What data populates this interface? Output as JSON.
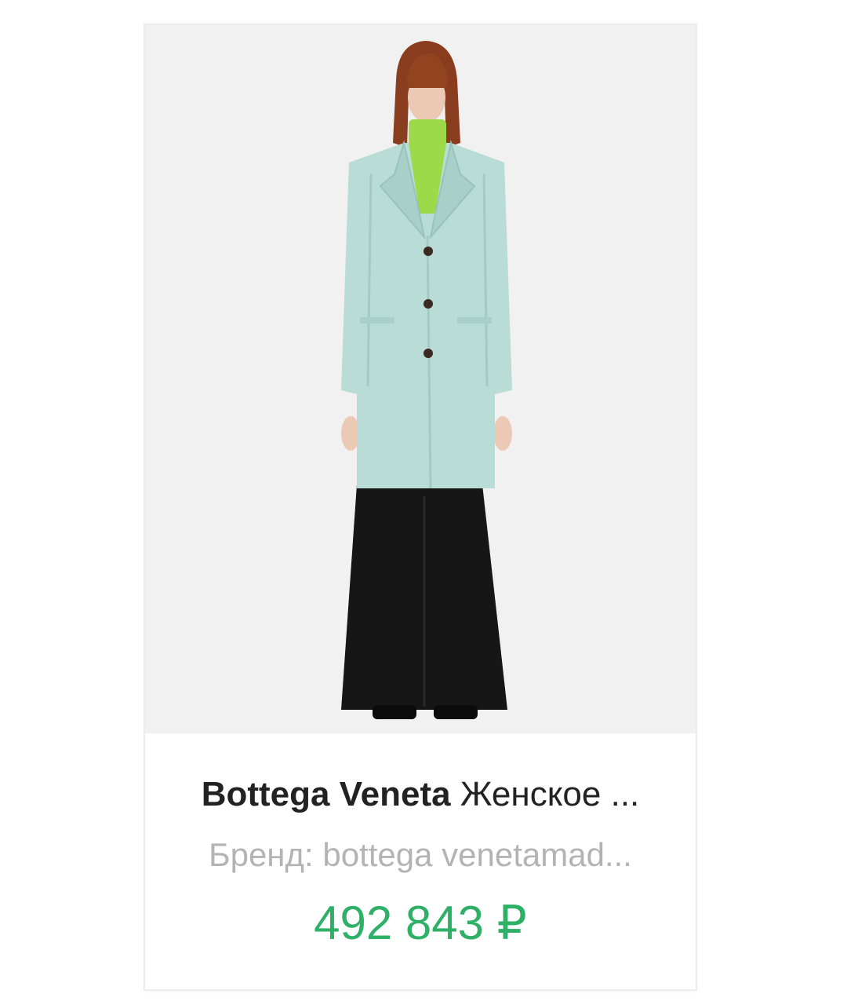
{
  "product": {
    "image_alt": "Bottega Veneta coat",
    "brand": "Bottega Veneta",
    "name_rest": "Женское ...",
    "subtitle": "Бренд: bottega venetamad...",
    "price": "492 843 ₽"
  },
  "colors": {
    "price": "#2fb067",
    "photo_background": "#f1f1f1",
    "coat": "#b9ddd6",
    "turtleneck": "#9ed94a",
    "trousers": "#161616"
  }
}
